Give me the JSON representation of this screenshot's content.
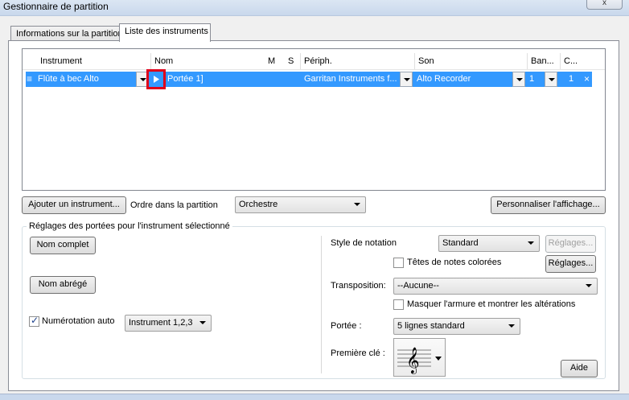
{
  "window": {
    "title": "Gestionnaire de partition",
    "close": "x"
  },
  "tabs": [
    {
      "label": "Informations sur la partition"
    },
    {
      "label": "Liste des instruments"
    }
  ],
  "list": {
    "headers": {
      "instrument": "Instrument",
      "nom": "Nom",
      "m": "M",
      "s": "S",
      "periph": "Périph.",
      "son": "Son",
      "banque": "Ban...",
      "canal": "C..."
    },
    "row": {
      "handle": "≡",
      "instrument": "Flûte à bec Alto",
      "nom": "Portée 1]",
      "periph": "Garritan Instruments f...",
      "son": "Alto Recorder",
      "banque": "1",
      "canal": "1",
      "remove": "×"
    }
  },
  "toolbar": {
    "add_instrument": "Ajouter un instrument...",
    "order_label": "Ordre dans la partition",
    "order_value": "Orchestre",
    "customize": "Personnaliser l'affichage..."
  },
  "staff_settings": {
    "group_title": "Réglages des portées pour l'instrument sélectionné",
    "full_name": "Nom complet",
    "short_name": "Nom abrégé",
    "auto_numbering_label": "Numérotation auto",
    "auto_numbering_checked": true,
    "auto_numbering_value": "Instrument 1,2,3",
    "notation_style_label": "Style de notation",
    "notation_style_value": "Standard",
    "notation_settings_disabled": "Réglages...",
    "colored_heads_label": "Têtes de notes colorées",
    "settings": "Réglages...",
    "transposition_label": "Transposition:",
    "transposition_value": "--Aucune--",
    "hide_key_label": "Masquer l'armure et montrer les altérations",
    "staff_label": "Portée :",
    "staff_value": "5 lignes standard",
    "first_clef_label": "Première clé :",
    "clef_icon": "treble-clef-icon",
    "help": "Aide"
  },
  "colors": {
    "selection": "#3399ff",
    "highlight_box": "#e0001a"
  }
}
